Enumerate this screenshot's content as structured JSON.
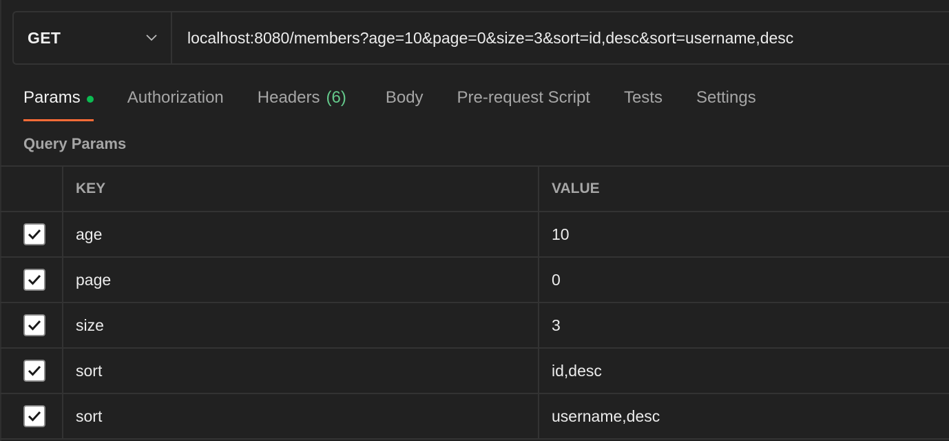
{
  "request": {
    "method": "GET",
    "url": "localhost:8080/members?age=10&page=0&size=3&sort=id,desc&sort=username,desc"
  },
  "tabs": [
    {
      "label": "Params",
      "active": true,
      "indicator": "green-dot"
    },
    {
      "label": "Authorization"
    },
    {
      "label": "Headers",
      "count": "(6)"
    },
    {
      "label": "Body"
    },
    {
      "label": "Pre-request Script"
    },
    {
      "label": "Tests"
    },
    {
      "label": "Settings"
    }
  ],
  "query_params": {
    "title": "Query Params",
    "columns": {
      "key": "KEY",
      "value": "VALUE"
    },
    "rows": [
      {
        "checked": true,
        "key": "age",
        "value": "10"
      },
      {
        "checked": true,
        "key": "page",
        "value": "0"
      },
      {
        "checked": true,
        "key": "size",
        "value": "3"
      },
      {
        "checked": true,
        "key": "sort",
        "value": "id,desc"
      },
      {
        "checked": true,
        "key": "sort",
        "value": "username,desc"
      }
    ]
  },
  "colors": {
    "background": "#212121",
    "active_tab_underline": "#ff6c37",
    "params_dot": "#0cbb52",
    "headers_count": "#64c98b"
  },
  "icons": {
    "method_dropdown": "chevron-down-icon",
    "checkbox": "checkmark-icon"
  }
}
